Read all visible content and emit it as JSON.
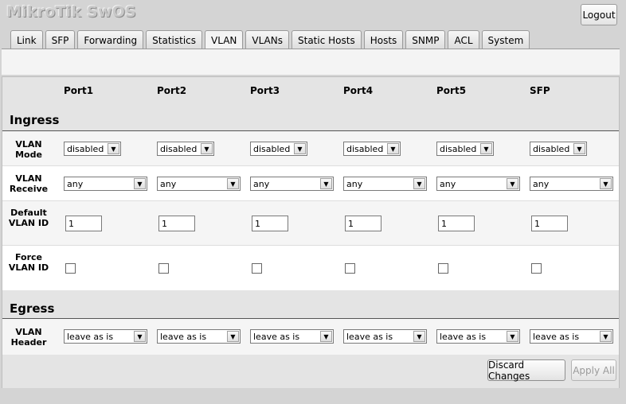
{
  "app": {
    "title": "MikroTik SwOS",
    "logout_label": "Logout"
  },
  "tabs": [
    "Link",
    "SFP",
    "Forwarding",
    "Statistics",
    "VLAN",
    "VLANs",
    "Static Hosts",
    "Hosts",
    "SNMP",
    "ACL",
    "System"
  ],
  "active_tab": "VLAN",
  "ports": [
    "Port1",
    "Port2",
    "Port3",
    "Port4",
    "Port5",
    "SFP"
  ],
  "ingress": {
    "title": "Ingress",
    "vlan_mode": {
      "label": "VLAN Mode",
      "values": [
        "disabled",
        "disabled",
        "disabled",
        "disabled",
        "disabled",
        "disabled"
      ]
    },
    "vlan_receive": {
      "label": "VLAN Receive",
      "values": [
        "any",
        "any",
        "any",
        "any",
        "any",
        "any"
      ]
    },
    "default_vlan_id": {
      "label": "Default VLAN ID",
      "values": [
        "1",
        "1",
        "1",
        "1",
        "1",
        "1"
      ]
    },
    "force_vlan_id": {
      "label": "Force VLAN ID",
      "values": [
        false,
        false,
        false,
        false,
        false,
        false
      ]
    }
  },
  "egress": {
    "title": "Egress",
    "vlan_header": {
      "label": "VLAN Header",
      "values": [
        "leave as is",
        "leave as is",
        "leave as is",
        "leave as is",
        "leave as is",
        "leave as is"
      ]
    }
  },
  "actions": {
    "discard_label": "Discard Changes",
    "apply_label": "Apply All"
  }
}
